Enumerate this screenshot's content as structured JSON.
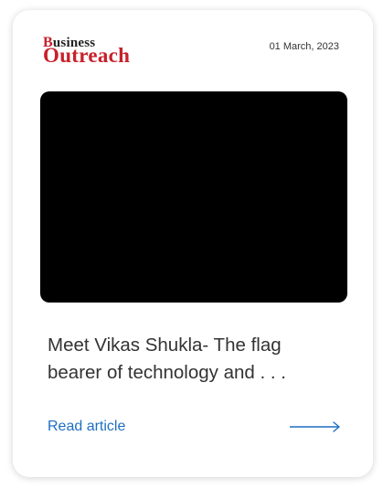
{
  "brand": {
    "logo_top_cap": "B",
    "logo_top_rest": "usiness",
    "logo_bottom": "Outreach"
  },
  "article": {
    "date": "01 March, 2023",
    "headline": "Meet Vikas Shukla- The flag bearer of technology and . . .",
    "read_label": "Read article"
  },
  "colors": {
    "brand_red": "#c8202a",
    "link_blue": "#1d6fc0",
    "media_bg": "#000000"
  },
  "icons": {
    "read_arrow": "arrow-right-icon"
  }
}
